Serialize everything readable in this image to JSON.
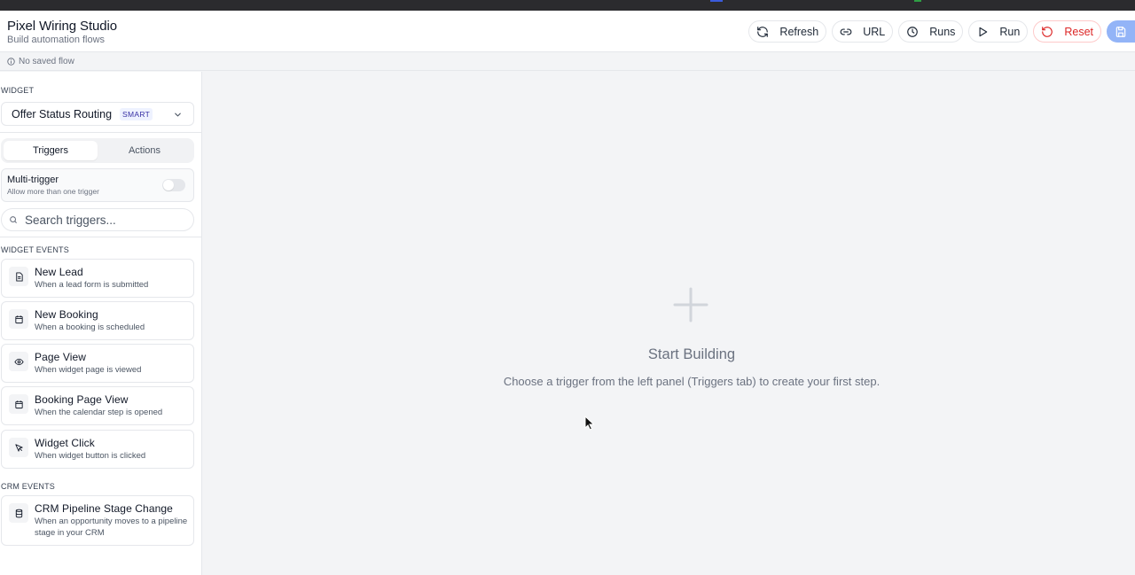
{
  "header": {
    "title": "Pixel Wiring Studio",
    "subtitle": "Build automation flows"
  },
  "toolbar": {
    "refresh_label": "Refresh",
    "url_label": "URL",
    "runs_label": "Runs",
    "run_label": "Run",
    "reset_label": "Reset"
  },
  "status": {
    "text": "No saved flow"
  },
  "sidebar": {
    "widget_label": "WIDGET",
    "widget_name": "Offer Status Routing",
    "widget_badge": "SMART",
    "tabs": [
      {
        "label": "Triggers",
        "active": true
      },
      {
        "label": "Actions",
        "active": false
      }
    ],
    "multi_trigger": {
      "title": "Multi-trigger",
      "desc": "Allow more than one trigger",
      "enabled": false
    },
    "search_placeholder": "Search triggers...",
    "widget_events_label": "WIDGET EVENTS",
    "widget_events": [
      {
        "title": "New Lead",
        "desc": "When a lead form is submitted",
        "icon": "document-icon"
      },
      {
        "title": "New Booking",
        "desc": "When a booking is scheduled",
        "icon": "calendar-icon"
      },
      {
        "title": "Page View",
        "desc": "When widget page is viewed",
        "icon": "eye-icon"
      },
      {
        "title": "Booking Page View",
        "desc": "When the calendar step is opened",
        "icon": "calendar-icon"
      },
      {
        "title": "Widget Click",
        "desc": "When widget button is clicked",
        "icon": "pointer-icon"
      }
    ],
    "crm_events_label": "CRM EVENTS",
    "crm_events": [
      {
        "title": "CRM Pipeline Stage Change",
        "desc": "When an opportunity moves to a pipeline stage in your CRM",
        "icon": "database-icon"
      }
    ]
  },
  "canvas": {
    "empty_title": "Start Building",
    "empty_desc": "Choose a trigger from the left panel (Triggers tab) to create your first step."
  },
  "colors": {
    "reset": "#dc2626",
    "save_button": "#93b4f7",
    "badge_text": "#3730a3"
  }
}
